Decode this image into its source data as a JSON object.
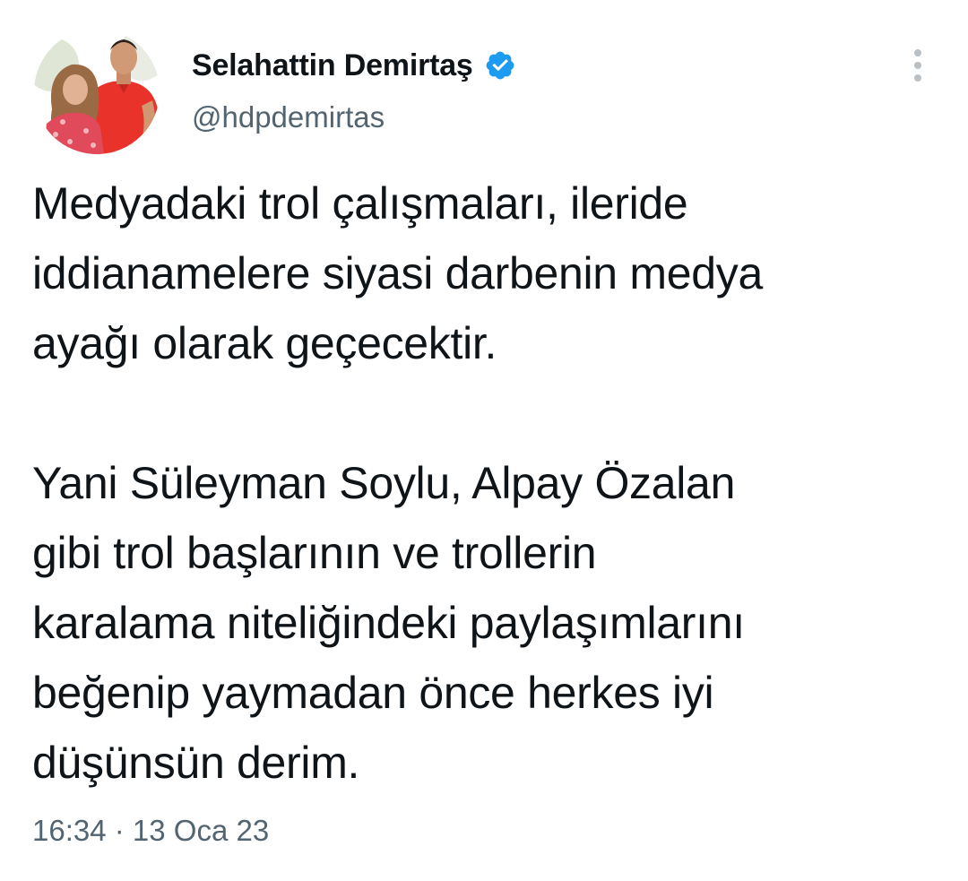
{
  "author": {
    "name": "Selahattin Demirtaş",
    "handle": "@hdpdemirtas",
    "verified_color": "#1d9bf0"
  },
  "tweet": {
    "paragraph1": [
      "Medyadaki trol çalışmaları, ileride",
      "iddianamelere siyasi darbenin medya",
      "ayağı olarak geçecektir."
    ],
    "paragraph2": [
      "Yani Süleyman Soylu, Alpay Özalan",
      "gibi trol başlarının ve trollerin",
      "karalama niteliğindeki paylaşımlarını",
      "beğenip yaymadan önce herkes iyi",
      "düşünsün derim."
    ]
  },
  "meta": {
    "time": "16:34",
    "separator": " · ",
    "date": "13 Oca 23"
  },
  "icons": {
    "verified": "verified-badge-icon",
    "more": "more-vertical-icon"
  }
}
